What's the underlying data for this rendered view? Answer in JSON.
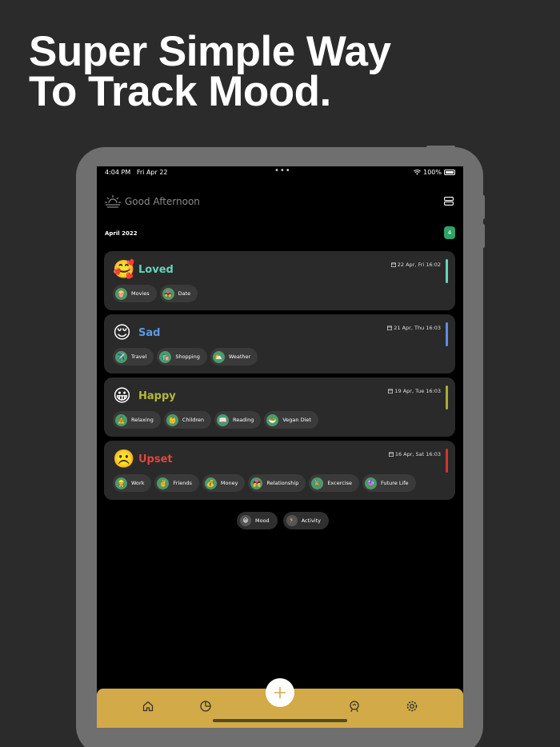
{
  "headline": {
    "line1": "Super Simple Way",
    "line2": "To Track Mood."
  },
  "status": {
    "time": "4:04 PM",
    "date": "Fri Apr 22",
    "dots": "•••",
    "battery": "100%"
  },
  "greeting": "Good Afternoon",
  "month": "April 2022",
  "entry_count": "4",
  "entries": [
    {
      "emoji": "🥰",
      "mood": "Loved",
      "color": "#5fd6b8",
      "bar": "#5fd6b8",
      "date": "22 Apr, Fri 16:02",
      "activities": [
        {
          "icon": "🍿",
          "label": "Movies"
        },
        {
          "icon": "💑",
          "label": "Date"
        }
      ]
    },
    {
      "emoji": "😌",
      "mood": "Sad",
      "color": "#5b9ae6",
      "bar": "#5b8de6",
      "date": "21 Apr, Thu 16:03",
      "activities": [
        {
          "icon": "✈️",
          "label": "Travel"
        },
        {
          "icon": "🛍️",
          "label": "Shopping"
        },
        {
          "icon": "⛅",
          "label": "Weather"
        }
      ]
    },
    {
      "emoji": "😀",
      "mood": "Happy",
      "color": "#b5b83a",
      "bar": "#a8ad2e",
      "date": "19 Apr, Tue 16:03",
      "activities": [
        {
          "icon": "🧘",
          "label": "Relaxing"
        },
        {
          "icon": "👶",
          "label": "Children"
        },
        {
          "icon": "📖",
          "label": "Reading"
        },
        {
          "icon": "🥗",
          "label": "Vegan Diet"
        }
      ]
    },
    {
      "emoji": "☹️",
      "mood": "Upset",
      "color": "#e0443e",
      "bar": "#d8322d",
      "date": "16 Apr, Sat 16:03",
      "activities": [
        {
          "icon": "👷",
          "label": "Work"
        },
        {
          "icon": "✌️",
          "label": "Friends"
        },
        {
          "icon": "💰",
          "label": "Money"
        },
        {
          "icon": "💏",
          "label": "Relationship"
        },
        {
          "icon": "🚴",
          "label": "Excercise"
        },
        {
          "icon": "🔮",
          "label": "Future Life"
        }
      ]
    }
  ],
  "filters": [
    {
      "icon": "😀",
      "label": "Mood"
    },
    {
      "icon": "🏃",
      "label": "Activity"
    }
  ],
  "tabs": [
    "home-icon",
    "chart-icon",
    "add-icon",
    "brain-icon",
    "gear-icon"
  ]
}
